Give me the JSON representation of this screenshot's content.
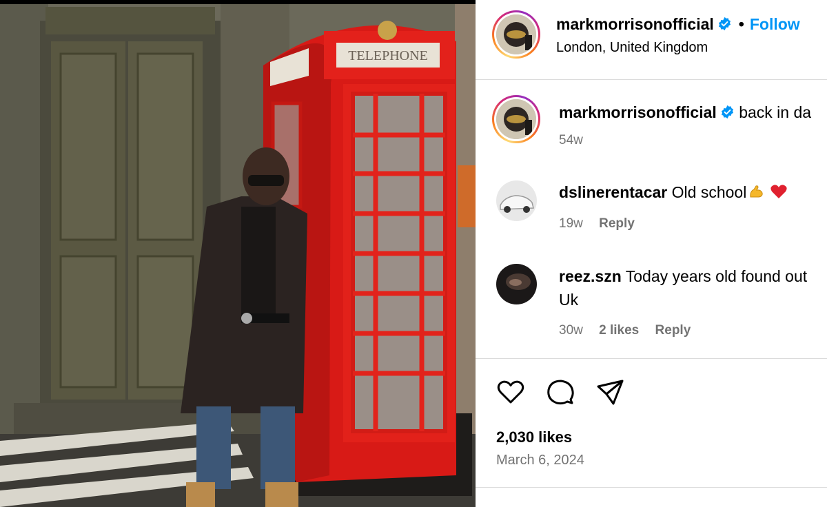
{
  "post": {
    "image_description": "Man in dark coat and sunglasses standing beside a red telephone box",
    "booth_sign": "TELEPHONE"
  },
  "header": {
    "username": "markmorrisonofficial",
    "separator": "•",
    "follow_label": "Follow",
    "location": "London, United Kingdom"
  },
  "caption": {
    "username": "markmorrisonofficial",
    "text": "back in da",
    "time": "54w"
  },
  "comments": [
    {
      "username": "dslinerentacar",
      "text": "Old school",
      "time": "19w",
      "reply_label": "Reply"
    },
    {
      "username": "reez.szn",
      "text": "Today years old found out",
      "text_line2": "Uk",
      "time": "30w",
      "likes": "2 likes",
      "reply_label": "Reply"
    }
  ],
  "footer": {
    "likes": "2,030 likes",
    "date": "March 6, 2024"
  },
  "colors": {
    "accent": "#0095f6",
    "muted": "#737373",
    "booth_red": "#e21f1a"
  },
  "icons": [
    "verified-badge-icon",
    "heart-icon",
    "comment-icon",
    "share-icon"
  ]
}
